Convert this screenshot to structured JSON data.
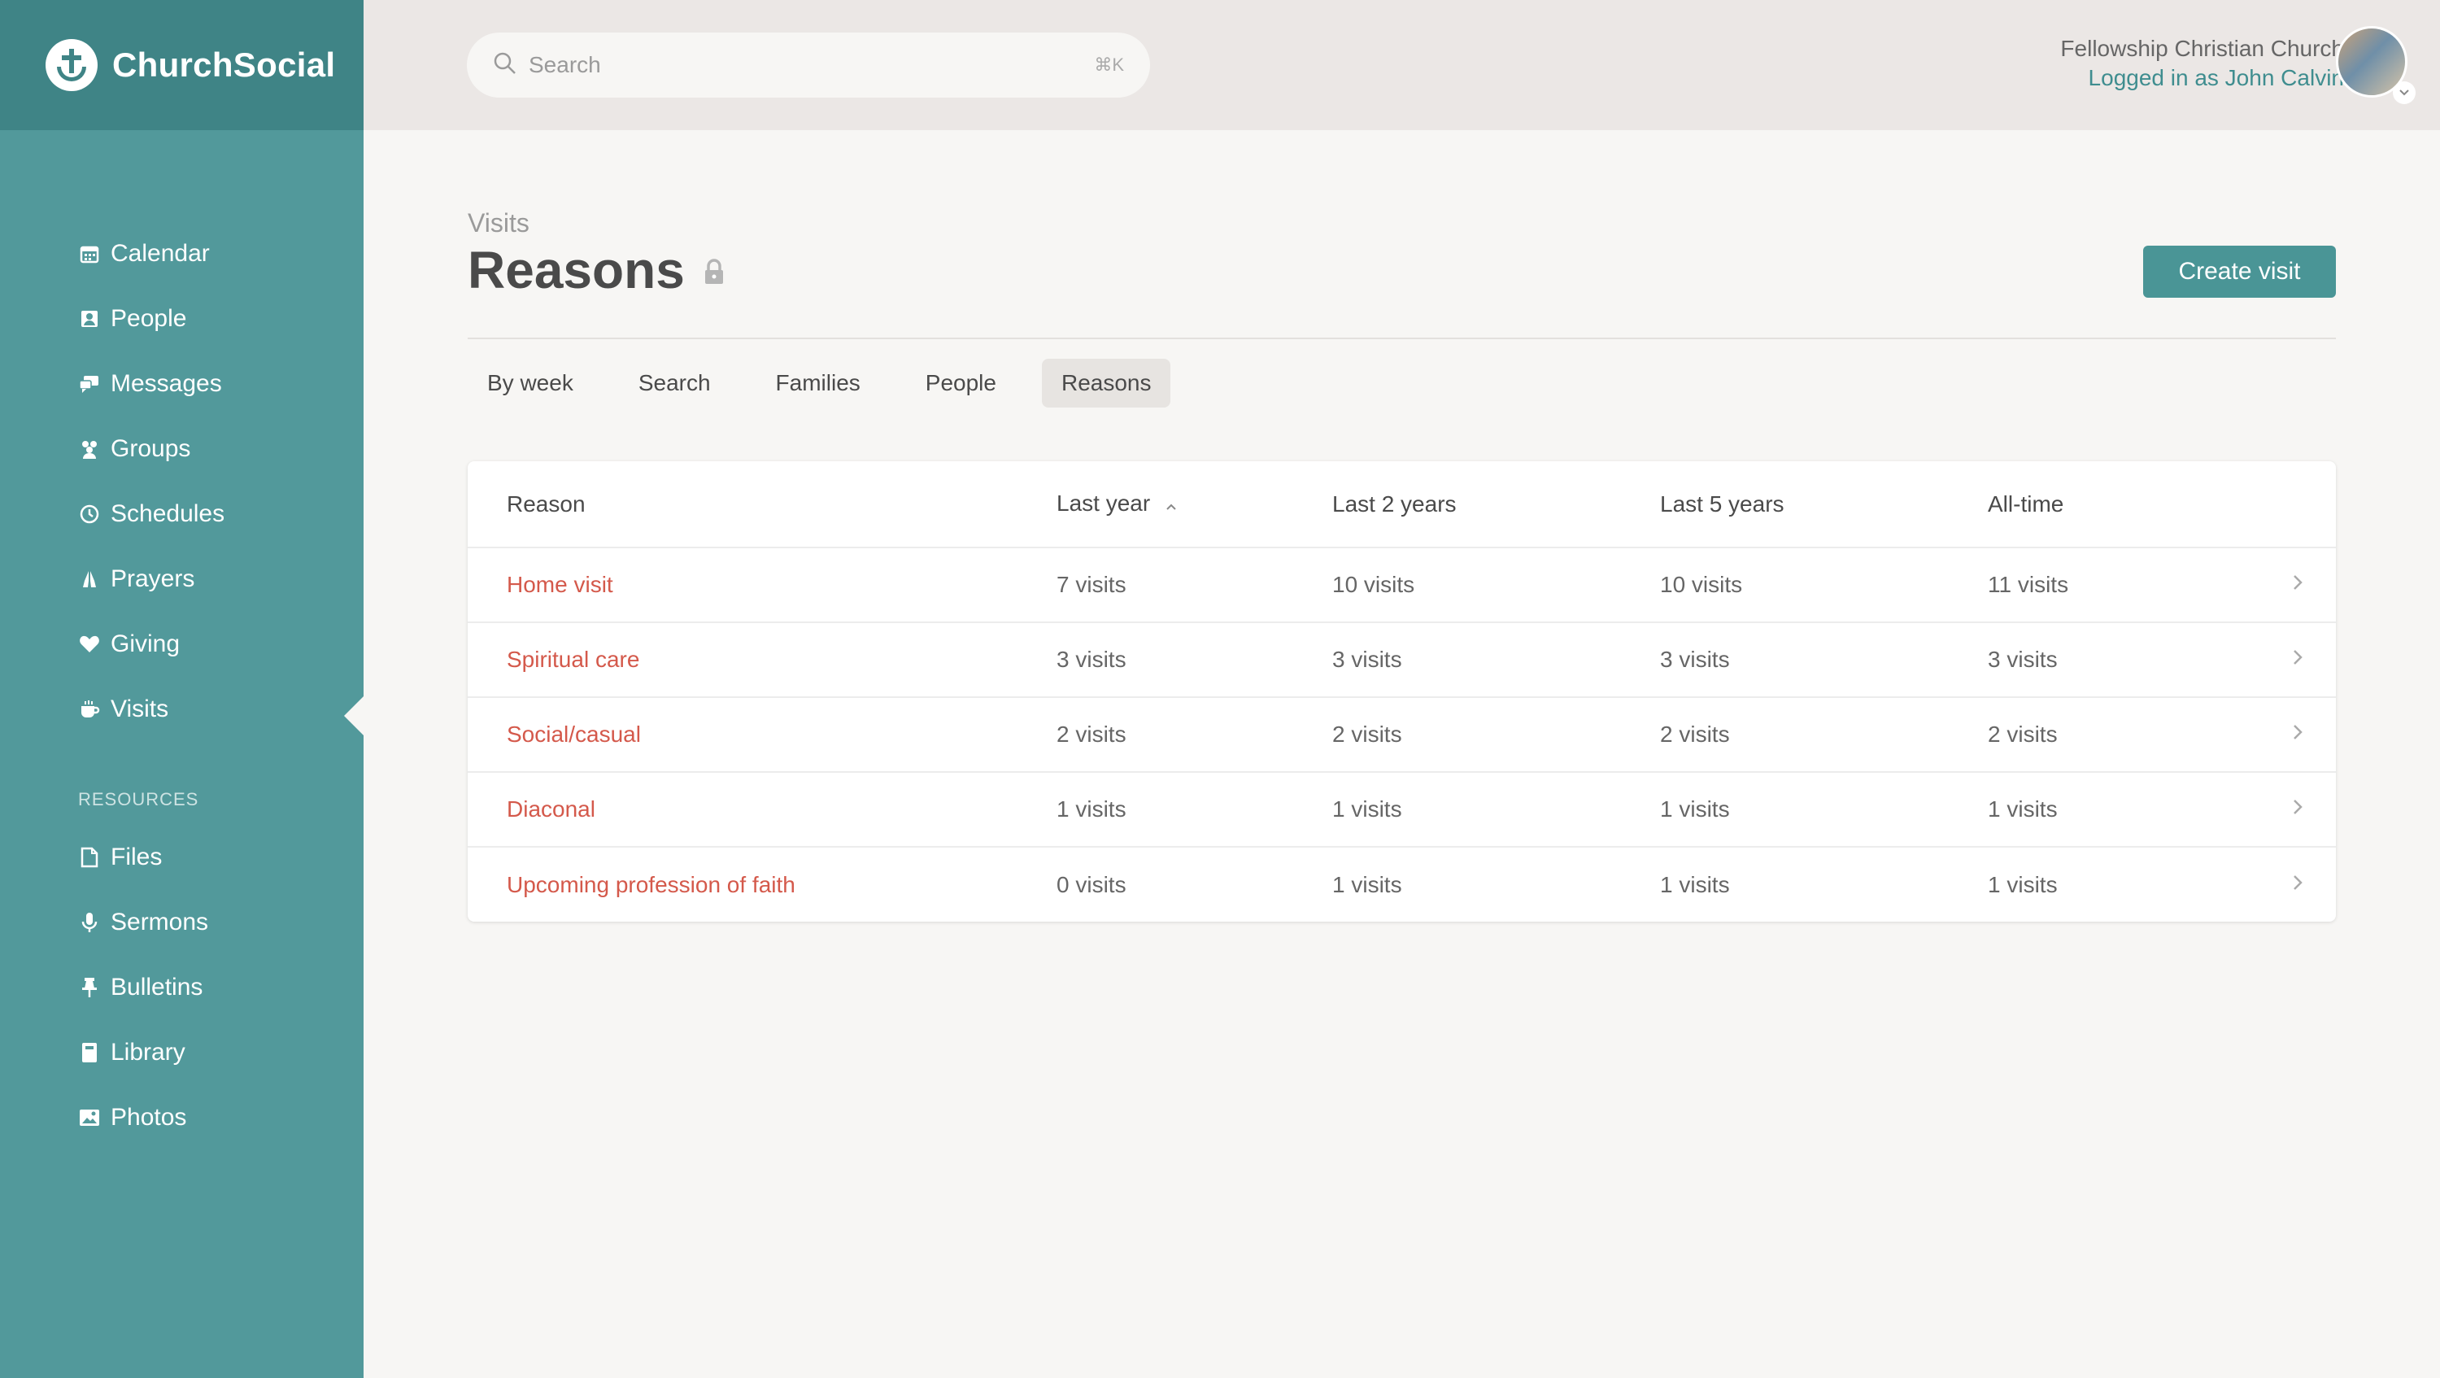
{
  "brand": {
    "name": "ChurchSocial"
  },
  "sidebar": {
    "items": [
      {
        "label": "Calendar",
        "icon": "calendar-icon"
      },
      {
        "label": "People",
        "icon": "person-card-icon"
      },
      {
        "label": "Messages",
        "icon": "chat-bubbles-icon"
      },
      {
        "label": "Groups",
        "icon": "group-icon"
      },
      {
        "label": "Schedules",
        "icon": "clock-icon"
      },
      {
        "label": "Prayers",
        "icon": "praying-hands-icon"
      },
      {
        "label": "Giving",
        "icon": "heart-icon"
      },
      {
        "label": "Visits",
        "icon": "coffee-cup-icon",
        "active": true
      }
    ],
    "resources_label": "RESOURCES",
    "resources": [
      {
        "label": "Files",
        "icon": "file-icon"
      },
      {
        "label": "Sermons",
        "icon": "microphone-icon"
      },
      {
        "label": "Bulletins",
        "icon": "pin-icon"
      },
      {
        "label": "Library",
        "icon": "book-icon"
      },
      {
        "label": "Photos",
        "icon": "photo-icon"
      }
    ]
  },
  "header": {
    "search_placeholder": "Search",
    "search_shortcut": "⌘K",
    "church_name": "Fellowship Christian Church",
    "logged_in": "Logged in as John Calvin"
  },
  "page": {
    "eyebrow": "Visits",
    "title": "Reasons",
    "create_label": "Create visit"
  },
  "tabs": [
    {
      "label": "By week"
    },
    {
      "label": "Search"
    },
    {
      "label": "Families"
    },
    {
      "label": "People"
    },
    {
      "label": "Reasons",
      "active": true
    }
  ],
  "table": {
    "headers": [
      "Reason",
      "Last year",
      "Last 2 years",
      "Last 5 years",
      "All-time"
    ],
    "rows": [
      [
        "Home visit",
        "7 visits",
        "10 visits",
        "10 visits",
        "11 visits"
      ],
      [
        "Spiritual care",
        "3 visits",
        "3 visits",
        "3 visits",
        "3 visits"
      ],
      [
        "Social/casual",
        "2 visits",
        "2 visits",
        "2 visits",
        "2 visits"
      ],
      [
        "Diaconal",
        "1 visits",
        "1 visits",
        "1 visits",
        "1 visits"
      ],
      [
        "Upcoming profession of faith",
        "0 visits",
        "1 visits",
        "1 visits",
        "1 visits"
      ]
    ]
  },
  "colors": {
    "sidebar": "#52999b",
    "brand_bar": "#3f8486",
    "accent": "#4a9596",
    "link_red": "#d4594b"
  }
}
